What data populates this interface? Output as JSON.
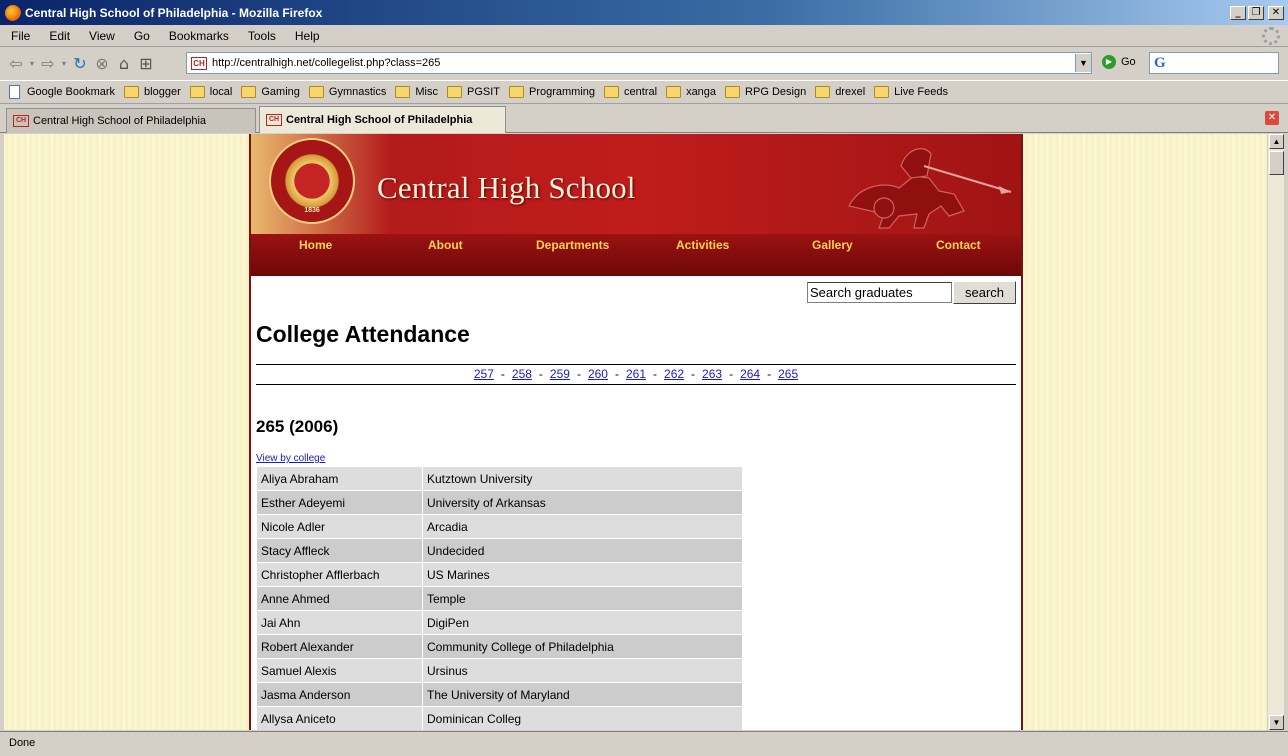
{
  "window": {
    "title": "Central High School of Philadelphia - Mozilla Firefox"
  },
  "menu": [
    "File",
    "Edit",
    "View",
    "Go",
    "Bookmarks",
    "Tools",
    "Help"
  ],
  "toolbar": {
    "url": "http://centralhigh.net/collegelist.php?class=265",
    "site_icon_text": "CH",
    "go_label": "Go",
    "search_engine_icon": "G"
  },
  "bookmarks": [
    {
      "label": "Google Bookmark",
      "icon": "page-icon"
    },
    {
      "label": "blogger",
      "icon": "folder-icon"
    },
    {
      "label": "local",
      "icon": "folder-icon"
    },
    {
      "label": "Gaming",
      "icon": "folder-icon"
    },
    {
      "label": "Gymnastics",
      "icon": "folder-icon"
    },
    {
      "label": "Misc",
      "icon": "folder-icon"
    },
    {
      "label": "PGSIT",
      "icon": "folder-icon"
    },
    {
      "label": "Programming",
      "icon": "folder-icon"
    },
    {
      "label": "central",
      "icon": "folder-icon"
    },
    {
      "label": "xanga",
      "icon": "folder-icon"
    },
    {
      "label": "RPG Design",
      "icon": "folder-icon"
    },
    {
      "label": "drexel",
      "icon": "folder-icon"
    },
    {
      "label": "Live Feeds",
      "icon": "folder-icon"
    }
  ],
  "tabs": [
    {
      "label": "Central High School of Philadelphia",
      "active": false
    },
    {
      "label": "Central High School of Philadelphia",
      "active": true
    }
  ],
  "site": {
    "banner_title": "Central High School",
    "seal_year": "1836",
    "nav": [
      "Home",
      "About",
      "Departments",
      "Activities",
      "Gallery",
      "Contact"
    ],
    "search_value": "Search graduates",
    "search_button": "search",
    "heading": "College Attendance",
    "class_links": [
      "257",
      "258",
      "259",
      "260",
      "261",
      "262",
      "263",
      "264",
      "265"
    ],
    "class_separator": "-",
    "class_heading": "265 (2006)",
    "view_by_college": "View by college",
    "graduates": [
      {
        "name": "Aliya Abraham",
        "college": "Kutztown University"
      },
      {
        "name": "Esther Adeyemi",
        "college": "University of Arkansas"
      },
      {
        "name": "Nicole Adler",
        "college": "Arcadia"
      },
      {
        "name": "Stacy Affleck",
        "college": "Undecided"
      },
      {
        "name": "Christopher Afflerbach",
        "college": "US Marines"
      },
      {
        "name": "Anne Ahmed",
        "college": "Temple"
      },
      {
        "name": "Jai Ahn",
        "college": "DigiPen"
      },
      {
        "name": "Robert Alexander",
        "college": "Community College of Philadelphia"
      },
      {
        "name": "Samuel Alexis",
        "college": "Ursinus"
      },
      {
        "name": "Jasma Anderson",
        "college": "The University of Maryland"
      },
      {
        "name": "Allysa Aniceto",
        "college": "Dominican Colleg"
      }
    ]
  },
  "status": "Done",
  "colors": {
    "banner_red": "#b31b1b",
    "nav_gold": "#ffd24a",
    "link_blue": "#1a1acc",
    "page_bg": "#fbf7d4"
  }
}
